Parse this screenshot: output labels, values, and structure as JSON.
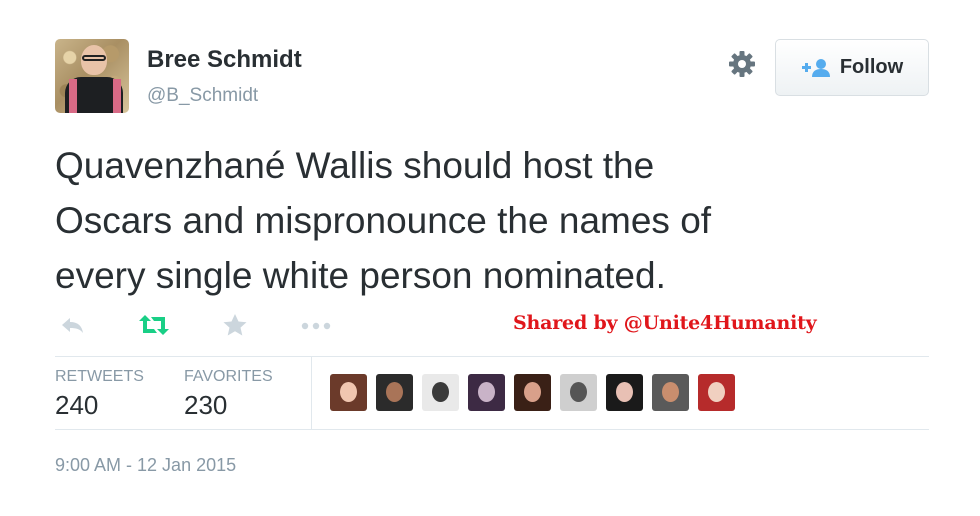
{
  "tweet": {
    "author": {
      "display_name": "Bree Schmidt",
      "handle": "@B_Schmidt",
      "avatar_icon": "user-avatar"
    },
    "text_lines": [
      "Quavenzhané Wallis should host the",
      "Oscars and mispronounce the names of",
      "every single white person nominated."
    ],
    "follow_button": {
      "label": "Follow",
      "icon": "add-user-icon"
    },
    "settings_icon": "gear-icon",
    "actions": [
      {
        "name": "reply",
        "icon": "reply-icon",
        "color": "#ccd6dd"
      },
      {
        "name": "retweet",
        "icon": "retweet-icon",
        "color": "#19cf86"
      },
      {
        "name": "favorite",
        "icon": "star-icon",
        "color": "#ccd6dd"
      },
      {
        "name": "more",
        "icon": "more-icon",
        "color": "#ccd6dd"
      }
    ],
    "watermark": "Shared by @Unite4Humanity",
    "stats": {
      "retweets_label": "RETWEETS",
      "retweets_value": "240",
      "favorites_label": "FAVORITES",
      "favorites_value": "230"
    },
    "favoriter_avatars": 9,
    "timestamp": "9:00 AM - 12 Jan 2015"
  },
  "colors": {
    "text": "#292f33",
    "muted": "#8899a6",
    "divider": "#e1e8ed",
    "watermark": "#e0161b",
    "follow_icon": "#55acee"
  }
}
